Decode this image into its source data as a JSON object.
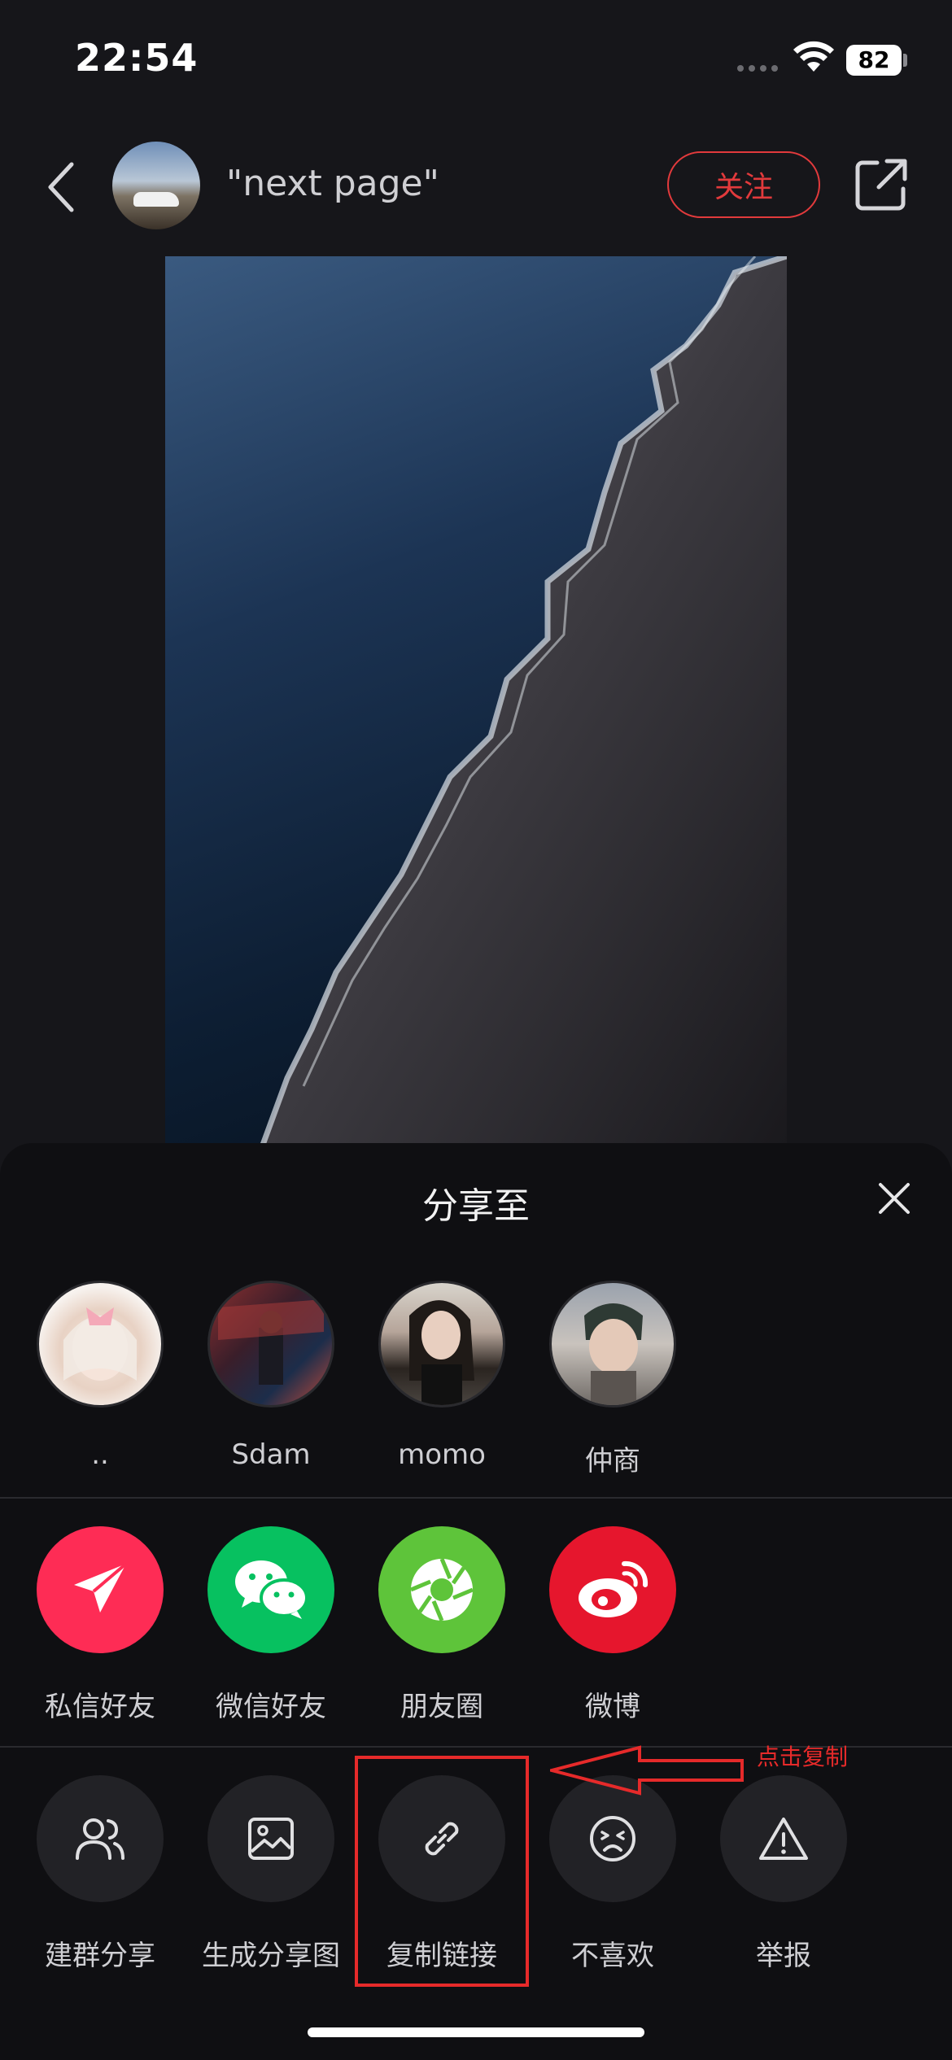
{
  "status_bar": {
    "time": "22:54",
    "battery": "82"
  },
  "header": {
    "title": "\"next page\"",
    "follow_label": "关注"
  },
  "share_sheet": {
    "title": "分享至",
    "contacts": [
      {
        "name": ".."
      },
      {
        "name": "Sdam"
      },
      {
        "name": "momo"
      },
      {
        "name": "仲商"
      }
    ],
    "apps": [
      {
        "label": "私信好友",
        "icon": "paper-plane-icon",
        "color": "#fe2c55"
      },
      {
        "label": "微信好友",
        "icon": "wechat-icon",
        "color": "#07c160"
      },
      {
        "label": "朋友圈",
        "icon": "moments-icon",
        "color": "#5ec43a"
      },
      {
        "label": "微博",
        "icon": "weibo-icon",
        "color": "#e6162d"
      }
    ],
    "tools": [
      {
        "label": "建群分享",
        "icon": "group-users-icon"
      },
      {
        "label": "生成分享图",
        "icon": "image-icon"
      },
      {
        "label": "复制链接",
        "icon": "link-icon"
      },
      {
        "label": "不喜欢",
        "icon": "dislike-face-icon"
      },
      {
        "label": "举报",
        "icon": "warning-icon"
      }
    ]
  },
  "annotation": {
    "text": "点击复制",
    "color": "#e62a2a"
  }
}
